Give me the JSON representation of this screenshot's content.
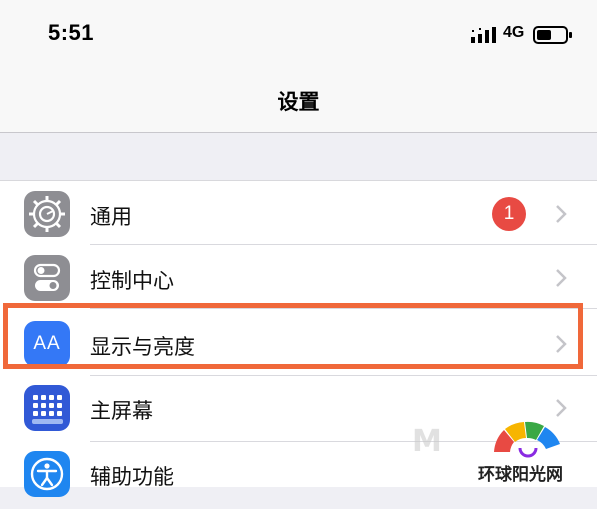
{
  "status_bar": {
    "time": "5:51",
    "network": "4G"
  },
  "nav": {
    "title": "设置"
  },
  "rows": [
    {
      "label": "通用",
      "icon": "gear-icon",
      "badge": "1"
    },
    {
      "label": "控制中心",
      "icon": "toggles-icon"
    },
    {
      "label": "显示与亮度",
      "icon": "display-brightness-icon",
      "icon_text": "AA"
    },
    {
      "label": "主屏幕",
      "icon": "home-screen-icon"
    },
    {
      "label": "辅助功能",
      "icon": "accessibility-icon"
    }
  ],
  "watermark": {
    "logo_text": "环球阳光网"
  },
  "colors": {
    "highlight": "#f0683a",
    "badge": "#e84a43",
    "display_icon": "#3478f6",
    "home_icon": "#3159d6",
    "accessibility_icon": "#1f86f0",
    "gray_icon": "#8e8e93"
  }
}
